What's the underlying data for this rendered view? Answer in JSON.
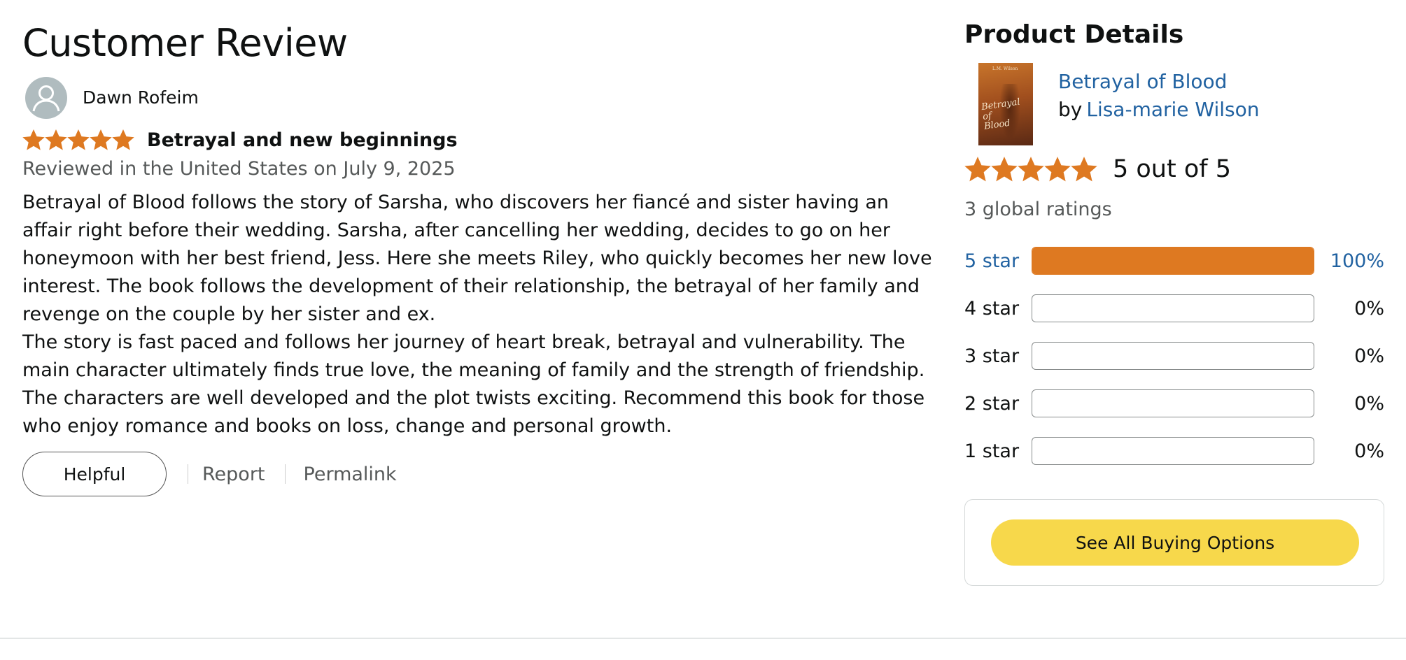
{
  "review": {
    "page_title": "Customer Review",
    "reviewer_name": "Dawn Rofeim",
    "rating": 5,
    "max_rating": 5,
    "title": "Betrayal and new beginnings",
    "date_line": "Reviewed in the United States on July 9, 2025",
    "body": [
      "Betrayal of Blood follows the story of Sarsha, who discovers her fiancé and sister having an affair right before their wedding. Sarsha, after cancelling her wedding, decides to go on her honeymoon with her best friend, Jess. Here she meets Riley, who quickly becomes her new love interest. The book follows the development of their relationship, the betrayal of her family and revenge on the couple by her sister and ex.",
      "The story is fast paced and follows her journey of heart break, betrayal and vulnerability. The main character ultimately finds true love, the meaning of family and the strength of friendship. The characters are well developed and the plot twists exciting. Recommend this book for those who enjoy romance and books on loss, change and personal growth."
    ],
    "actions": {
      "helpful": "Helpful",
      "report": "Report",
      "permalink": "Permalink"
    }
  },
  "product": {
    "section_title": "Product Details",
    "book_title": "Betrayal of Blood",
    "by_label": "by",
    "author": "Lisa-marie Wilson",
    "cover_title_line1": "Betrayal of",
    "cover_title_line2": "Blood",
    "cover_author": "L.M. Wilson",
    "overall_rating": 5,
    "overall_text": "5 out of 5",
    "global_ratings": "3 global ratings",
    "histogram": [
      {
        "label": "5 star",
        "percent_text": "100%",
        "fraction": 1.0
      },
      {
        "label": "4 star",
        "percent_text": "0%",
        "fraction": 0
      },
      {
        "label": "3 star",
        "percent_text": "0%",
        "fraction": 0
      },
      {
        "label": "2 star",
        "percent_text": "0%",
        "fraction": 0
      },
      {
        "label": "1 star",
        "percent_text": "0%",
        "fraction": 0
      }
    ],
    "buy_button": "See All Buying Options"
  },
  "colors": {
    "star": "#de7921",
    "link": "#2162a1",
    "buy_button": "#f7d84b",
    "bar_fill": "#de7921"
  }
}
